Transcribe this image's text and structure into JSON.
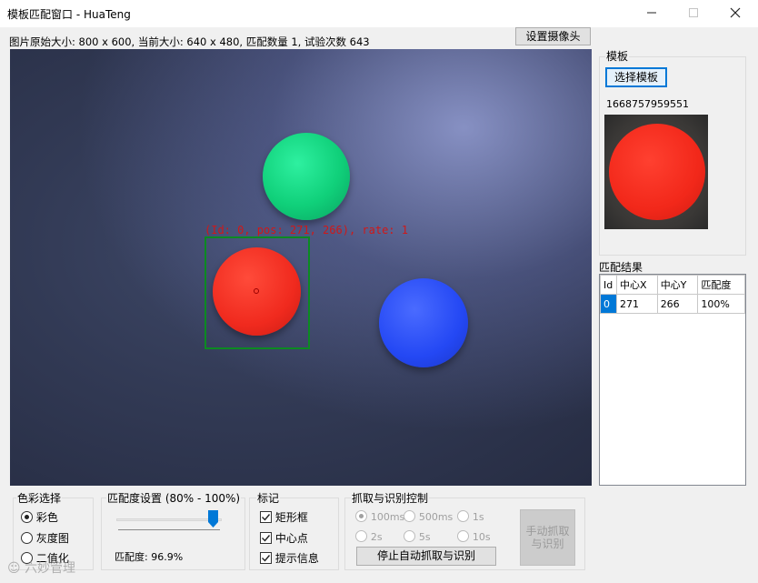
{
  "window": {
    "title": "模板匹配窗口 - HuaTeng",
    "minimize_icon": "minimize-icon",
    "maximize_icon": "maximize-icon",
    "close_icon": "close-icon"
  },
  "info_bar": {
    "text": "图片原始大小: 800 x 600, 当前大小: 640 x 480, 匹配数量 1, 试验次数 643",
    "camera_button": "设置摄像头"
  },
  "camera": {
    "overlay_label": "(Id: 0, pos: 271, 266), rate: 1"
  },
  "template": {
    "group_title": "模板",
    "choose_button": "选择模板",
    "template_id": "1668757959551"
  },
  "results": {
    "title": "匹配结果",
    "columns": [
      "Id",
      "中心X",
      "中心Y",
      "匹配度"
    ],
    "rows": [
      [
        "0",
        "271",
        "266",
        "100%"
      ]
    ]
  },
  "color_select": {
    "title": "色彩选择",
    "options": [
      "彩色",
      "灰度图",
      "二值化"
    ],
    "selected": "彩色"
  },
  "match_rate": {
    "title": "匹配度设置 (80% - 100%)",
    "value_label": "匹配度: 96.9%",
    "slider_value": 0.845
  },
  "marks": {
    "title": "标记",
    "items": [
      {
        "label": "矩形框",
        "checked": true
      },
      {
        "label": "中心点",
        "checked": true
      },
      {
        "label": "提示信息",
        "checked": true
      }
    ]
  },
  "grab": {
    "title": "抓取与识别控制",
    "intervals": [
      "100ms",
      "500ms",
      "1s",
      "2s",
      "5s",
      "10s"
    ],
    "selected_interval": "100ms",
    "stop_button": "停止自动抓取与识别",
    "manual_button": "手动抓取与识别"
  },
  "watermark": "六妙管理",
  "colors": {
    "accent": "#0078d7",
    "match_box": "#0c8a22",
    "overlay_text": "#d01818"
  }
}
